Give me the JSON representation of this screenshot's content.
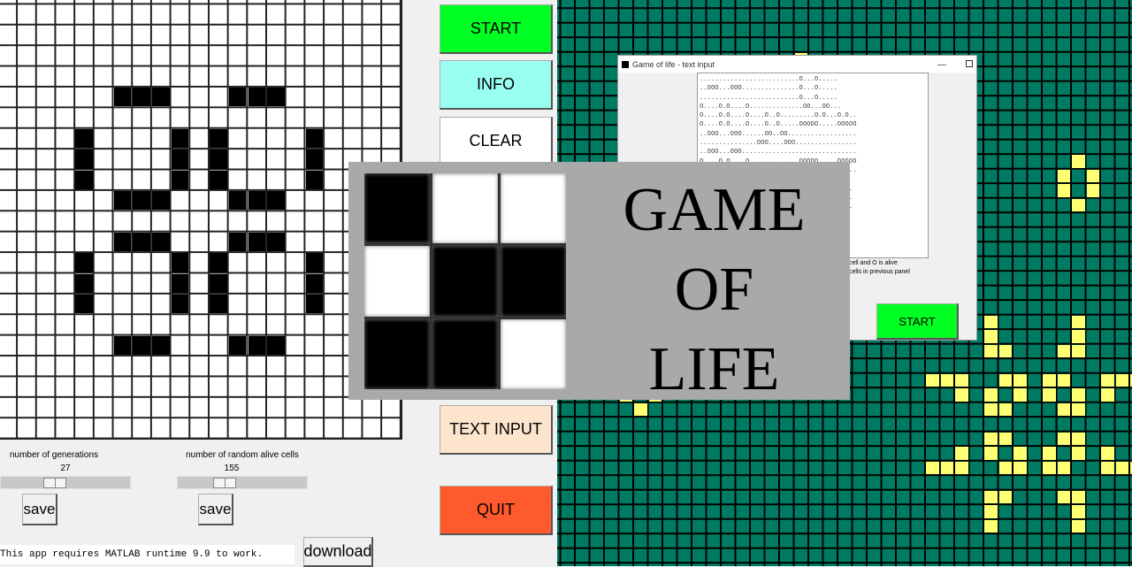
{
  "main": {
    "buttons": {
      "start": "START",
      "info": "INFO",
      "clear": "CLEAR",
      "text_input": "TEXT INPUT",
      "quit": "QUIT"
    },
    "generations": {
      "label": "number of generations",
      "value": "27",
      "save": "save",
      "slider_fraction": 0.4
    },
    "random_cells": {
      "label": "number of random alive cells",
      "value": "155",
      "save": "save",
      "slider_fraction": 0.33
    },
    "runtime_note": "This app requires MATLAB runtime 9.9 to work.",
    "download": "download",
    "board_alive_cells": [
      [
        4,
        6
      ],
      [
        4,
        7
      ],
      [
        4,
        8
      ],
      [
        4,
        12
      ],
      [
        4,
        13
      ],
      [
        4,
        14
      ],
      [
        6,
        4
      ],
      [
        7,
        4
      ],
      [
        8,
        4
      ],
      [
        6,
        9
      ],
      [
        7,
        9
      ],
      [
        8,
        9
      ],
      [
        6,
        11
      ],
      [
        7,
        11
      ],
      [
        8,
        11
      ],
      [
        6,
        16
      ],
      [
        7,
        16
      ],
      [
        8,
        16
      ],
      [
        9,
        6
      ],
      [
        9,
        7
      ],
      [
        9,
        8
      ],
      [
        9,
        12
      ],
      [
        9,
        13
      ],
      [
        9,
        14
      ],
      [
        11,
        6
      ],
      [
        11,
        7
      ],
      [
        11,
        8
      ],
      [
        11,
        12
      ],
      [
        11,
        13
      ],
      [
        11,
        14
      ],
      [
        12,
        4
      ],
      [
        13,
        4
      ],
      [
        14,
        4
      ],
      [
        12,
        9
      ],
      [
        13,
        9
      ],
      [
        14,
        9
      ],
      [
        12,
        11
      ],
      [
        13,
        11
      ],
      [
        14,
        11
      ],
      [
        12,
        16
      ],
      [
        13,
        16
      ],
      [
        14,
        16
      ],
      [
        16,
        6
      ],
      [
        16,
        7
      ],
      [
        16,
        8
      ],
      [
        16,
        12
      ],
      [
        16,
        13
      ],
      [
        16,
        14
      ]
    ]
  },
  "preview_board": {
    "colors": {
      "background": "#007b63",
      "alive": "#ffff73"
    },
    "alive_cells": [
      [
        3,
        16
      ],
      [
        10,
        35
      ],
      [
        11,
        34
      ],
      [
        11,
        36
      ],
      [
        12,
        34
      ],
      [
        12,
        36
      ],
      [
        13,
        35
      ],
      [
        26,
        4
      ],
      [
        26,
        6
      ],
      [
        27,
        5
      ],
      [
        21,
        29
      ],
      [
        21,
        35
      ],
      [
        22,
        29
      ],
      [
        22,
        35
      ],
      [
        23,
        29
      ],
      [
        23,
        30
      ],
      [
        23,
        34
      ],
      [
        23,
        35
      ],
      [
        25,
        25
      ],
      [
        25,
        26
      ],
      [
        25,
        27
      ],
      [
        25,
        30
      ],
      [
        25,
        31
      ],
      [
        25,
        33
      ],
      [
        25,
        34
      ],
      [
        25,
        37
      ],
      [
        25,
        38
      ],
      [
        25,
        39
      ],
      [
        26,
        27
      ],
      [
        26,
        29
      ],
      [
        26,
        31
      ],
      [
        26,
        33
      ],
      [
        26,
        35
      ],
      [
        26,
        37
      ],
      [
        27,
        29
      ],
      [
        27,
        30
      ],
      [
        27,
        34
      ],
      [
        27,
        35
      ],
      [
        29,
        29
      ],
      [
        29,
        30
      ],
      [
        29,
        34
      ],
      [
        29,
        35
      ],
      [
        30,
        27
      ],
      [
        30,
        29
      ],
      [
        30,
        31
      ],
      [
        30,
        33
      ],
      [
        30,
        35
      ],
      [
        30,
        37
      ],
      [
        31,
        25
      ],
      [
        31,
        26
      ],
      [
        31,
        27
      ],
      [
        31,
        30
      ],
      [
        31,
        31
      ],
      [
        31,
        33
      ],
      [
        31,
        34
      ],
      [
        31,
        37
      ],
      [
        31,
        38
      ],
      [
        31,
        39
      ],
      [
        33,
        29
      ],
      [
        33,
        30
      ],
      [
        33,
        34
      ],
      [
        33,
        35
      ],
      [
        34,
        29
      ],
      [
        34,
        35
      ],
      [
        35,
        29
      ],
      [
        35,
        35
      ]
    ]
  },
  "text_window": {
    "title": "Game of life - text input",
    "text": "..........................O...O.....\n..OOO...OOO...............O...O.....\n..........................O...O.....\nO....O.O....O..............OO...OO...\nO....O.O....O....O..O.........O.O...O.O..\nO....O.O....O....O..O.....OOOOO.....OOOOO\n..OOO...OOO......OO..OO..................\n...............OOO....OOO................\n..OOO...OOO..............................\nO....O.O....O.............OOOOO.....OOOOO\n..............................O.O...O.O..\n.................................OO....\n..................................O.....\n..................................O.....\n..................................O.....",
    "hint_line1": "cell and O is alive",
    "hint_line2": "cells in previous panel",
    "start": "START"
  },
  "logo": {
    "title_lines": [
      "GAME",
      "OF",
      "LIFE"
    ],
    "pattern": [
      [
        1,
        0,
        0
      ],
      [
        0,
        1,
        1
      ],
      [
        1,
        1,
        0
      ]
    ]
  }
}
